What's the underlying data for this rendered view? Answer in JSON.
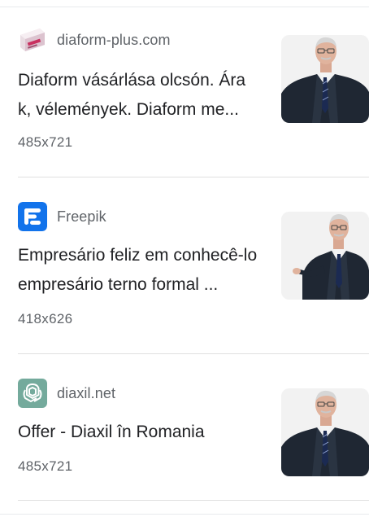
{
  "results": [
    {
      "source": "diaform-plus.com",
      "favicon_icon": "diaform-box-icon",
      "title": "Diaform vásárlása olcsón. Ára k, vélemények. Diaform me...",
      "dimensions": "485x721"
    },
    {
      "source": "Freepik",
      "favicon_icon": "freepik-logo-icon",
      "favicon_color": "#1273eb",
      "title": "Empresário feliz em conhecê-lo empresário terno formal ...",
      "dimensions": "418x626"
    },
    {
      "source": "diaxil.net",
      "favicon_icon": "openai-knot-icon",
      "favicon_color": "#74aa9c",
      "title": "Offer - Diaxil în Romania",
      "dimensions": "485x721"
    }
  ]
}
